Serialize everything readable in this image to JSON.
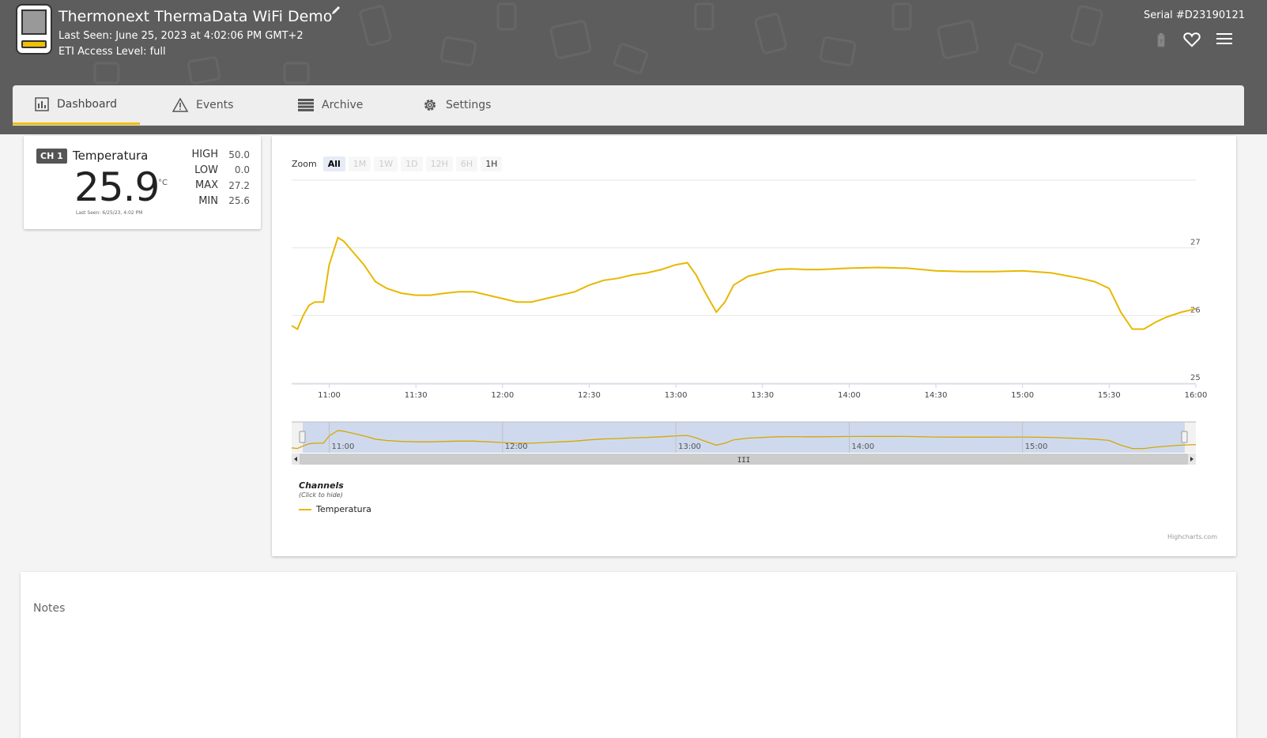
{
  "device": {
    "title": "Thermonext ThermaData WiFi Demo",
    "last_seen": "Last Seen: June 25, 2023 at 4:02:06 PM GMT+2",
    "access_level": "ETI Access Level: full",
    "serial": "Serial #D23190121"
  },
  "tabs": [
    {
      "label": "Dashboard",
      "icon": "bar-chart-icon"
    },
    {
      "label": "Events",
      "icon": "warning-icon"
    },
    {
      "label": "Archive",
      "icon": "list-icon"
    },
    {
      "label": "Settings",
      "icon": "gear-icon"
    }
  ],
  "channel": {
    "badge": "CH 1",
    "name": "Temperatura",
    "value": "25.9",
    "unit": "°C",
    "last_seen": "Last Seen: 6/25/23, 4:02 PM",
    "stats": [
      {
        "label": "HIGH",
        "value": "50.0"
      },
      {
        "label": "LOW",
        "value": "0.0"
      },
      {
        "label": "MAX",
        "value": "27.2"
      },
      {
        "label": "MIN",
        "value": "25.6"
      }
    ]
  },
  "zoom": {
    "label": "Zoom",
    "buttons": [
      "All",
      "1M",
      "1W",
      "1D",
      "12H",
      "6H",
      "1H"
    ]
  },
  "legend": {
    "title": "Channels",
    "subtitle": "(Click to hide)",
    "item": "Temperatura"
  },
  "credits": "Highcharts.com",
  "notes": {
    "label": "Notes"
  },
  "colors": {
    "header": "#5d5d5d",
    "accent": "#f0c000",
    "series": "#e8b800"
  },
  "chart_data": {
    "type": "line",
    "x_unit": "time (HH:MM)",
    "xlim": [
      "10:47",
      "16:00"
    ],
    "ylim": [
      25,
      28
    ],
    "x_ticks": [
      "11:00",
      "11:30",
      "12:00",
      "12:30",
      "13:00",
      "13:30",
      "14:00",
      "14:30",
      "15:00",
      "15:30",
      "16:00"
    ],
    "y_ticks": [
      "25",
      "26",
      "27"
    ],
    "navigator_ticks": [
      "11:00",
      "12:00",
      "13:00",
      "14:00",
      "15:00"
    ],
    "series": [
      {
        "name": "Temperatura",
        "points": [
          [
            "10:47",
            25.85
          ],
          [
            "10:49",
            25.8
          ],
          [
            "10:51",
            26.0
          ],
          [
            "10:53",
            26.15
          ],
          [
            "10:55",
            26.2
          ],
          [
            "10:58",
            26.2
          ],
          [
            "11:00",
            26.75
          ],
          [
            "11:03",
            27.15
          ],
          [
            "11:05",
            27.1
          ],
          [
            "11:08",
            26.95
          ],
          [
            "11:12",
            26.75
          ],
          [
            "11:16",
            26.5
          ],
          [
            "11:20",
            26.4
          ],
          [
            "11:25",
            26.33
          ],
          [
            "11:30",
            26.3
          ],
          [
            "11:35",
            26.3
          ],
          [
            "11:40",
            26.33
          ],
          [
            "11:45",
            26.35
          ],
          [
            "11:50",
            26.35
          ],
          [
            "11:55",
            26.3
          ],
          [
            "12:00",
            26.25
          ],
          [
            "12:05",
            26.2
          ],
          [
            "12:10",
            26.2
          ],
          [
            "12:15",
            26.25
          ],
          [
            "12:20",
            26.3
          ],
          [
            "12:25",
            26.35
          ],
          [
            "12:30",
            26.45
          ],
          [
            "12:35",
            26.52
          ],
          [
            "12:40",
            26.55
          ],
          [
            "12:45",
            26.6
          ],
          [
            "12:50",
            26.63
          ],
          [
            "12:55",
            26.68
          ],
          [
            "13:00",
            26.75
          ],
          [
            "13:04",
            26.78
          ],
          [
            "13:07",
            26.6
          ],
          [
            "13:10",
            26.35
          ],
          [
            "13:14",
            26.05
          ],
          [
            "13:17",
            26.2
          ],
          [
            "13:20",
            26.45
          ],
          [
            "13:25",
            26.58
          ],
          [
            "13:30",
            26.63
          ],
          [
            "13:35",
            26.68
          ],
          [
            "13:40",
            26.69
          ],
          [
            "13:45",
            26.68
          ],
          [
            "13:50",
            26.68
          ],
          [
            "14:00",
            26.7
          ],
          [
            "14:10",
            26.71
          ],
          [
            "14:20",
            26.7
          ],
          [
            "14:30",
            26.66
          ],
          [
            "14:40",
            26.65
          ],
          [
            "14:50",
            26.65
          ],
          [
            "15:00",
            26.66
          ],
          [
            "15:10",
            26.63
          ],
          [
            "15:20",
            26.55
          ],
          [
            "15:25",
            26.5
          ],
          [
            "15:30",
            26.4
          ],
          [
            "15:34",
            26.05
          ],
          [
            "15:38",
            25.8
          ],
          [
            "15:42",
            25.8
          ],
          [
            "15:46",
            25.9
          ],
          [
            "15:50",
            25.98
          ],
          [
            "15:55",
            26.05
          ],
          [
            "16:00",
            26.1
          ]
        ]
      }
    ]
  }
}
